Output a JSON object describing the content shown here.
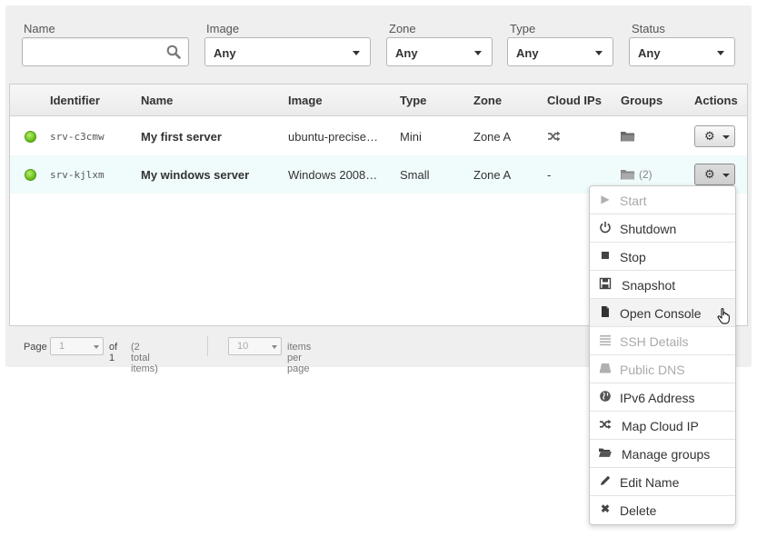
{
  "filters": {
    "name_label": "Name",
    "name_value": "",
    "image_label": "Image",
    "image_value": "Any",
    "zone_label": "Zone",
    "zone_value": "Any",
    "type_label": "Type",
    "type_value": "Any",
    "status_label": "Status",
    "status_value": "Any"
  },
  "table": {
    "headers": [
      "Identifier",
      "Name",
      "Image",
      "Type",
      "Zone",
      "Cloud IPs",
      "Groups",
      "Actions"
    ],
    "rows": [
      {
        "status": "active",
        "identifier": "srv-c3cmw",
        "name": "My first server",
        "image": "ubuntu-precise…",
        "type": "Mini",
        "zone": "Zone A",
        "cloud_ips": "",
        "cloud_ips_icon": "shuffle-icon",
        "groups": "",
        "groups_icon": "folder-icon"
      },
      {
        "status": "active",
        "identifier": "srv-kjlxm",
        "name": "My windows server",
        "image": "Windows 2008…",
        "type": "Small",
        "zone": "Zone A",
        "cloud_ips": "-",
        "groups": "(2)",
        "groups_icon": "folder-icon"
      }
    ]
  },
  "pagination": {
    "page_label": "Page",
    "page_value": "1",
    "of_label": "of 1",
    "total_items": "(2 total items)",
    "per_page_value": "10",
    "per_page_label": "items per page"
  },
  "actions_menu": {
    "items": [
      {
        "label": "Start",
        "icon": "play-icon",
        "disabled": true
      },
      {
        "label": "Shutdown",
        "icon": "power-icon",
        "disabled": false
      },
      {
        "label": "Stop",
        "icon": "stop-icon",
        "disabled": false
      },
      {
        "label": "Snapshot",
        "icon": "floppy-disk-icon",
        "disabled": false
      },
      {
        "label": "Open Console",
        "icon": "document-icon",
        "disabled": false,
        "hovered": true
      },
      {
        "label": "SSH Details",
        "icon": "list-icon",
        "disabled": true
      },
      {
        "label": "Public DNS",
        "icon": "drive-icon",
        "disabled": true
      },
      {
        "label": "IPv6 Address",
        "icon": "globe-icon",
        "disabled": false
      },
      {
        "label": "Map Cloud IP",
        "icon": "shuffle-icon",
        "disabled": false
      },
      {
        "label": "Manage groups",
        "icon": "folder-open-icon",
        "disabled": false
      },
      {
        "label": "Edit Name",
        "icon": "pencil-icon",
        "disabled": false
      },
      {
        "label": "Delete",
        "icon": "close-icon",
        "disabled": false
      }
    ]
  },
  "colors": {
    "status_active": "#5fb814",
    "row_highlight": "#f0fbfb",
    "disabled_text": "#aaaaaa"
  }
}
